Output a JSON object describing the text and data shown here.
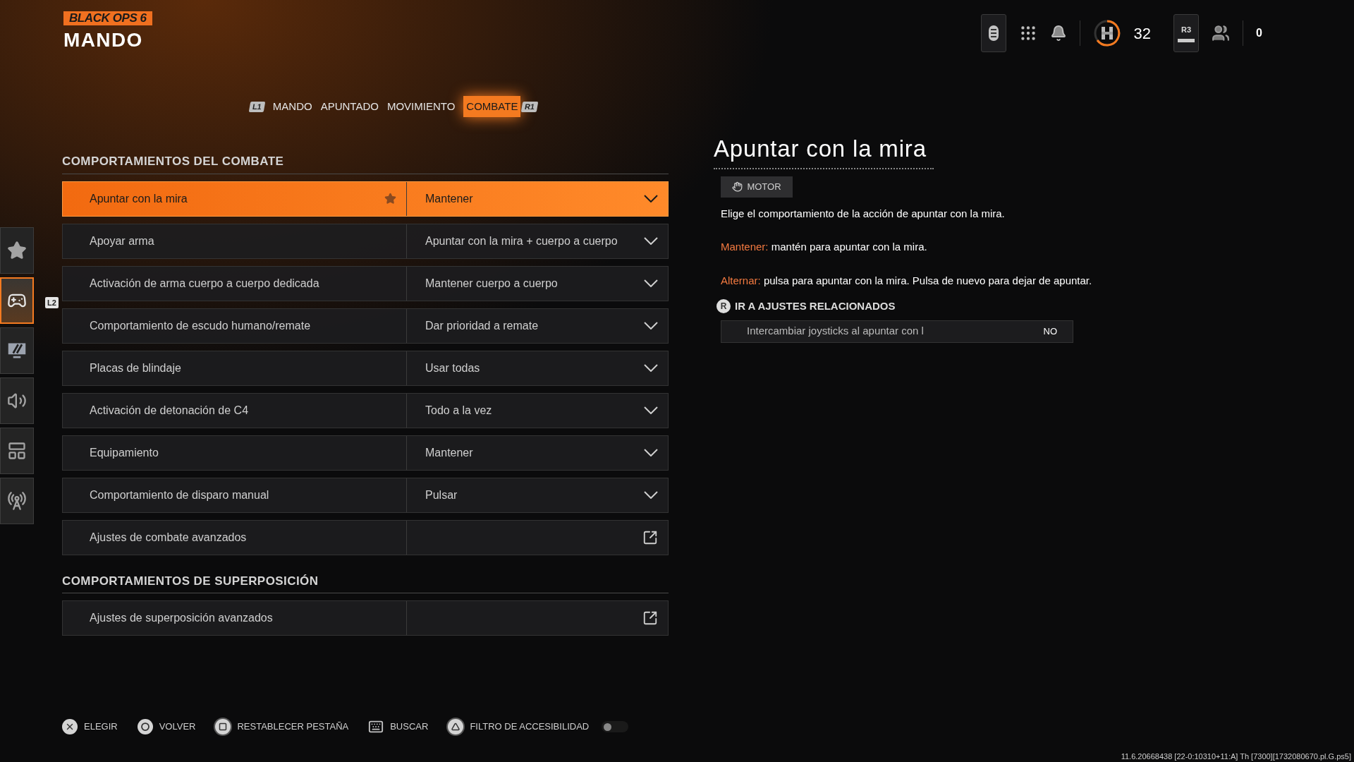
{
  "logo": "BLACK OPS 6",
  "page_title": "MANDO",
  "top_bar": {
    "level": "32",
    "r3_key": "R3",
    "friends_count": "0"
  },
  "tabs": {
    "prev_key": "L1",
    "next_key": "R1",
    "items": [
      {
        "label": "MANDO",
        "selected": false
      },
      {
        "label": "APUNTADO",
        "selected": false
      },
      {
        "label": "MOVIMIENTO",
        "selected": false
      },
      {
        "label": "COMBATE",
        "selected": true
      }
    ]
  },
  "sidebar": {
    "badge": "L2",
    "items": [
      {
        "kind": "star",
        "selected": false
      },
      {
        "kind": "controller",
        "selected": true
      },
      {
        "kind": "display",
        "selected": false
      },
      {
        "kind": "audio",
        "selected": false
      },
      {
        "kind": "interface",
        "selected": false
      },
      {
        "kind": "network",
        "selected": false
      }
    ]
  },
  "sections": [
    {
      "title": "COMPORTAMIENTOS DEL COMBATE",
      "rows": [
        {
          "label": "Apuntar con la mira",
          "value": "Mantener",
          "kind": "dropdown",
          "selected": true,
          "starred": true
        },
        {
          "label": "Apoyar arma",
          "value": "Apuntar con la mira + cuerpo a cuerpo",
          "kind": "dropdown",
          "selected": false,
          "starred": false
        },
        {
          "label": "Activación de arma cuerpo a cuerpo dedicada",
          "value": "Mantener cuerpo a cuerpo",
          "kind": "dropdown",
          "selected": false,
          "starred": false
        },
        {
          "label": "Comportamiento de escudo humano/remate",
          "value": "Dar prioridad a remate",
          "kind": "dropdown",
          "selected": false,
          "starred": false
        },
        {
          "label": "Placas de blindaje",
          "value": "Usar todas",
          "kind": "dropdown",
          "selected": false,
          "starred": false
        },
        {
          "label": "Activación de detonación de C4",
          "value": "Todo a la vez",
          "kind": "dropdown",
          "selected": false,
          "starred": false
        },
        {
          "label": "Equipamiento",
          "value": "Mantener",
          "kind": "dropdown",
          "selected": false,
          "starred": false
        },
        {
          "label": "Comportamiento de disparo manual",
          "value": "Pulsar",
          "kind": "dropdown",
          "selected": false,
          "starred": false
        },
        {
          "label": "Ajustes de combate avanzados",
          "kind": "link",
          "selected": false,
          "starred": false
        }
      ]
    },
    {
      "title": "COMPORTAMIENTOS DE SUPERPOSICIÓN",
      "rows": [
        {
          "label": "Ajustes de superposición avanzados",
          "kind": "link",
          "selected": false,
          "starred": false
        }
      ]
    }
  ],
  "detail": {
    "title": "Apuntar con la mira",
    "tag": "MOTOR",
    "description": "Elige el comportamiento de la acción de apuntar con la mira.",
    "options": [
      {
        "term": "Mantener:",
        "text": "mantén para apuntar con la mira."
      },
      {
        "term": "Alternar:",
        "text": "pulsa para apuntar con la mira. Pulsa de nuevo para dejar de apuntar."
      }
    ],
    "related_key": "R",
    "related_header": "IR A AJUSTES RELACIONADOS",
    "related_rows": [
      {
        "label": "Intercambiar joysticks al apuntar con l",
        "value": "NO"
      }
    ]
  },
  "footer": {
    "actions": [
      {
        "kind": "cross",
        "label": "ELEGIR"
      },
      {
        "kind": "circle",
        "label": "VOLVER"
      },
      {
        "kind": "square",
        "label": "RESTABLECER PESTAÑA"
      },
      {
        "kind": "keyboard",
        "label": "BUSCAR"
      },
      {
        "kind": "triangle",
        "label": "FILTRO DE ACCESIBILIDAD"
      }
    ],
    "accessibility_filter_on": false
  },
  "build_info": "11.6.20668438 [22-0:10310+11:A] Th [7300][1732080670.pl.G.ps5]"
}
